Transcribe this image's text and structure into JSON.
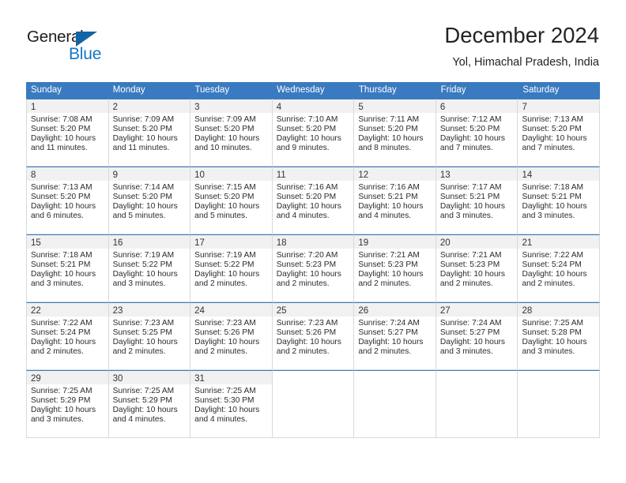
{
  "brand": {
    "name_part1": "General",
    "name_part2": "Blue",
    "triangle_color": "#1464a5",
    "blue_color": "#1277c4"
  },
  "header": {
    "title": "December 2024",
    "subtitle": "Yol, Himachal Pradesh, India"
  },
  "theme": {
    "header_bar_color": "#3a7ac0",
    "daynum_strip_color": "#f1f1f1",
    "cell_border_color": "#d9d9d9"
  },
  "weekdays": [
    "Sunday",
    "Monday",
    "Tuesday",
    "Wednesday",
    "Thursday",
    "Friday",
    "Saturday"
  ],
  "weeks": [
    [
      {
        "day": "1",
        "lines": [
          "Sunrise: 7:08 AM",
          "Sunset: 5:20 PM",
          "Daylight: 10 hours",
          "and 11 minutes."
        ]
      },
      {
        "day": "2",
        "lines": [
          "Sunrise: 7:09 AM",
          "Sunset: 5:20 PM",
          "Daylight: 10 hours",
          "and 11 minutes."
        ]
      },
      {
        "day": "3",
        "lines": [
          "Sunrise: 7:09 AM",
          "Sunset: 5:20 PM",
          "Daylight: 10 hours",
          "and 10 minutes."
        ]
      },
      {
        "day": "4",
        "lines": [
          "Sunrise: 7:10 AM",
          "Sunset: 5:20 PM",
          "Daylight: 10 hours",
          "and 9 minutes."
        ]
      },
      {
        "day": "5",
        "lines": [
          "Sunrise: 7:11 AM",
          "Sunset: 5:20 PM",
          "Daylight: 10 hours",
          "and 8 minutes."
        ]
      },
      {
        "day": "6",
        "lines": [
          "Sunrise: 7:12 AM",
          "Sunset: 5:20 PM",
          "Daylight: 10 hours",
          "and 7 minutes."
        ]
      },
      {
        "day": "7",
        "lines": [
          "Sunrise: 7:13 AM",
          "Sunset: 5:20 PM",
          "Daylight: 10 hours",
          "and 7 minutes."
        ]
      }
    ],
    [
      {
        "day": "8",
        "lines": [
          "Sunrise: 7:13 AM",
          "Sunset: 5:20 PM",
          "Daylight: 10 hours",
          "and 6 minutes."
        ]
      },
      {
        "day": "9",
        "lines": [
          "Sunrise: 7:14 AM",
          "Sunset: 5:20 PM",
          "Daylight: 10 hours",
          "and 5 minutes."
        ]
      },
      {
        "day": "10",
        "lines": [
          "Sunrise: 7:15 AM",
          "Sunset: 5:20 PM",
          "Daylight: 10 hours",
          "and 5 minutes."
        ]
      },
      {
        "day": "11",
        "lines": [
          "Sunrise: 7:16 AM",
          "Sunset: 5:20 PM",
          "Daylight: 10 hours",
          "and 4 minutes."
        ]
      },
      {
        "day": "12",
        "lines": [
          "Sunrise: 7:16 AM",
          "Sunset: 5:21 PM",
          "Daylight: 10 hours",
          "and 4 minutes."
        ]
      },
      {
        "day": "13",
        "lines": [
          "Sunrise: 7:17 AM",
          "Sunset: 5:21 PM",
          "Daylight: 10 hours",
          "and 3 minutes."
        ]
      },
      {
        "day": "14",
        "lines": [
          "Sunrise: 7:18 AM",
          "Sunset: 5:21 PM",
          "Daylight: 10 hours",
          "and 3 minutes."
        ]
      }
    ],
    [
      {
        "day": "15",
        "lines": [
          "Sunrise: 7:18 AM",
          "Sunset: 5:21 PM",
          "Daylight: 10 hours",
          "and 3 minutes."
        ]
      },
      {
        "day": "16",
        "lines": [
          "Sunrise: 7:19 AM",
          "Sunset: 5:22 PM",
          "Daylight: 10 hours",
          "and 3 minutes."
        ]
      },
      {
        "day": "17",
        "lines": [
          "Sunrise: 7:19 AM",
          "Sunset: 5:22 PM",
          "Daylight: 10 hours",
          "and 2 minutes."
        ]
      },
      {
        "day": "18",
        "lines": [
          "Sunrise: 7:20 AM",
          "Sunset: 5:23 PM",
          "Daylight: 10 hours",
          "and 2 minutes."
        ]
      },
      {
        "day": "19",
        "lines": [
          "Sunrise: 7:21 AM",
          "Sunset: 5:23 PM",
          "Daylight: 10 hours",
          "and 2 minutes."
        ]
      },
      {
        "day": "20",
        "lines": [
          "Sunrise: 7:21 AM",
          "Sunset: 5:23 PM",
          "Daylight: 10 hours",
          "and 2 minutes."
        ]
      },
      {
        "day": "21",
        "lines": [
          "Sunrise: 7:22 AM",
          "Sunset: 5:24 PM",
          "Daylight: 10 hours",
          "and 2 minutes."
        ]
      }
    ],
    [
      {
        "day": "22",
        "lines": [
          "Sunrise: 7:22 AM",
          "Sunset: 5:24 PM",
          "Daylight: 10 hours",
          "and 2 minutes."
        ]
      },
      {
        "day": "23",
        "lines": [
          "Sunrise: 7:23 AM",
          "Sunset: 5:25 PM",
          "Daylight: 10 hours",
          "and 2 minutes."
        ]
      },
      {
        "day": "24",
        "lines": [
          "Sunrise: 7:23 AM",
          "Sunset: 5:26 PM",
          "Daylight: 10 hours",
          "and 2 minutes."
        ]
      },
      {
        "day": "25",
        "lines": [
          "Sunrise: 7:23 AM",
          "Sunset: 5:26 PM",
          "Daylight: 10 hours",
          "and 2 minutes."
        ]
      },
      {
        "day": "26",
        "lines": [
          "Sunrise: 7:24 AM",
          "Sunset: 5:27 PM",
          "Daylight: 10 hours",
          "and 2 minutes."
        ]
      },
      {
        "day": "27",
        "lines": [
          "Sunrise: 7:24 AM",
          "Sunset: 5:27 PM",
          "Daylight: 10 hours",
          "and 3 minutes."
        ]
      },
      {
        "day": "28",
        "lines": [
          "Sunrise: 7:25 AM",
          "Sunset: 5:28 PM",
          "Daylight: 10 hours",
          "and 3 minutes."
        ]
      }
    ],
    [
      {
        "day": "29",
        "lines": [
          "Sunrise: 7:25 AM",
          "Sunset: 5:29 PM",
          "Daylight: 10 hours",
          "and 3 minutes."
        ]
      },
      {
        "day": "30",
        "lines": [
          "Sunrise: 7:25 AM",
          "Sunset: 5:29 PM",
          "Daylight: 10 hours",
          "and 4 minutes."
        ]
      },
      {
        "day": "31",
        "lines": [
          "Sunrise: 7:25 AM",
          "Sunset: 5:30 PM",
          "Daylight: 10 hours",
          "and 4 minutes."
        ]
      },
      {
        "day": "",
        "lines": []
      },
      {
        "day": "",
        "lines": []
      },
      {
        "day": "",
        "lines": []
      },
      {
        "day": "",
        "lines": []
      }
    ]
  ]
}
